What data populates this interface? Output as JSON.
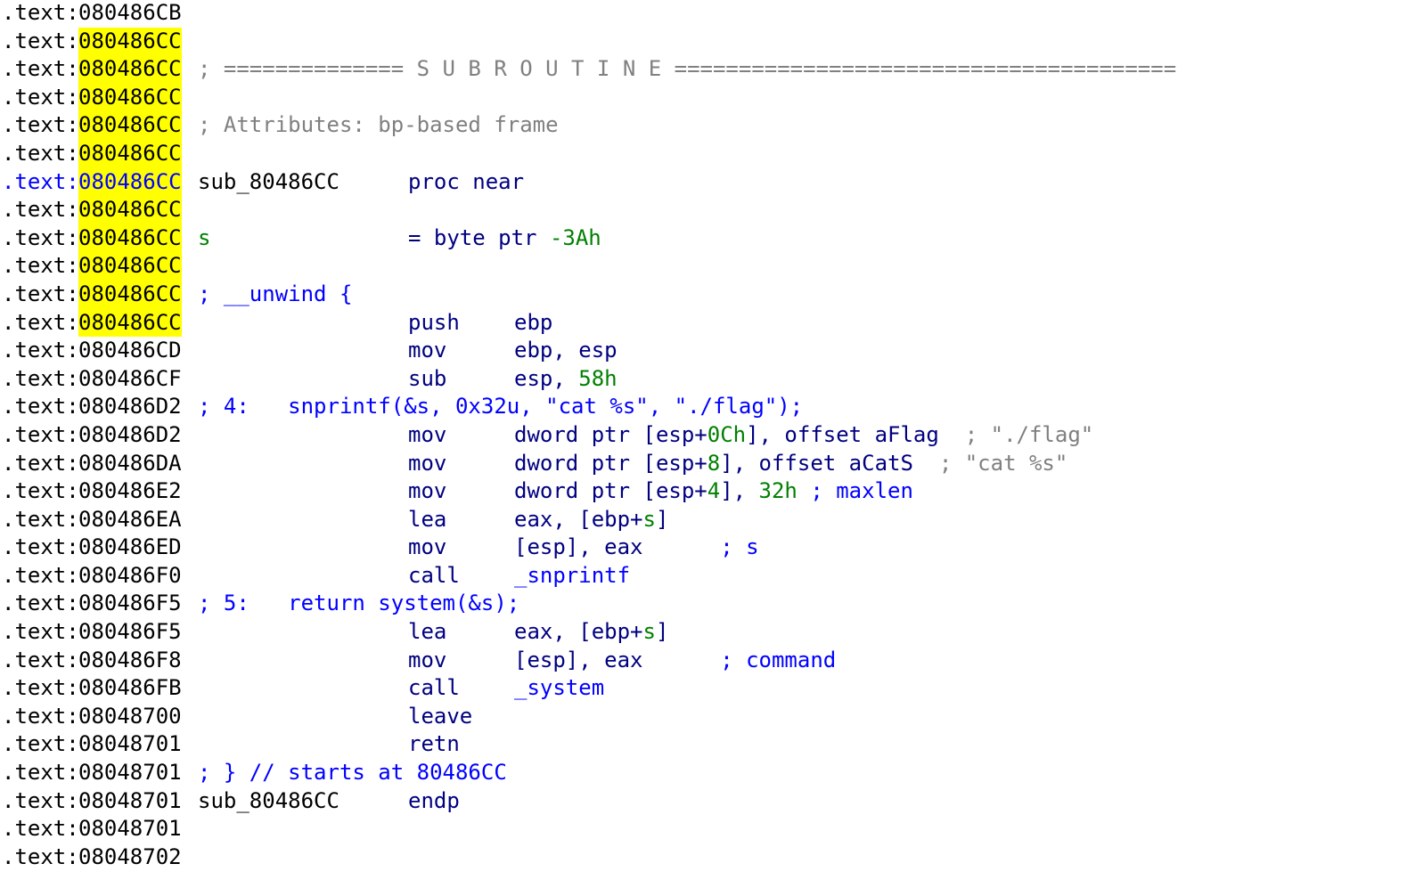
{
  "view": {
    "lines": [
      {
        "segment": ".text:",
        "address": "080486CB",
        "highlight": false,
        "seg_color": "black",
        "parts": []
      },
      {
        "segment": ".text:",
        "address": "080486CC",
        "highlight": true,
        "seg_color": "black",
        "parts": []
      },
      {
        "segment": ".text:",
        "address": "080486CC",
        "highlight": true,
        "seg_color": "black",
        "parts": [
          {
            "col": "c1",
            "text": "; ============== S U B R O U T I N E =======================================",
            "color": "gray"
          }
        ]
      },
      {
        "segment": ".text:",
        "address": "080486CC",
        "highlight": true,
        "seg_color": "black",
        "parts": []
      },
      {
        "segment": ".text:",
        "address": "080486CC",
        "highlight": true,
        "seg_color": "black",
        "parts": [
          {
            "col": "c1",
            "text": "; Attributes: bp-based frame",
            "color": "gray"
          }
        ]
      },
      {
        "segment": ".text:",
        "address": "080486CC",
        "highlight": true,
        "seg_color": "black",
        "parts": []
      },
      {
        "segment": ".text:",
        "address": "080486CC",
        "highlight": true,
        "seg_color": "blue",
        "parts": [
          {
            "col": "c1",
            "text": "sub_80486CC",
            "color": "black"
          },
          {
            "col": "c2",
            "text": "proc near",
            "color": "navy"
          }
        ]
      },
      {
        "segment": ".text:",
        "address": "080486CC",
        "highlight": true,
        "seg_color": "black",
        "parts": []
      },
      {
        "segment": ".text:",
        "address": "080486CC",
        "highlight": true,
        "seg_color": "black",
        "parts": [
          {
            "col": "c1",
            "text": "s",
            "color": "green"
          },
          {
            "col": "c2",
            "text": "= byte ptr ",
            "color": "navy"
          },
          {
            "col": "c2",
            "text": "           -3Ah",
            "color": "green"
          }
        ]
      },
      {
        "segment": ".text:",
        "address": "080486CC",
        "highlight": true,
        "seg_color": "black",
        "parts": []
      },
      {
        "segment": ".text:",
        "address": "080486CC",
        "highlight": true,
        "seg_color": "black",
        "parts": [
          {
            "col": "c1",
            "text": "; __unwind {",
            "color": "blue"
          }
        ]
      },
      {
        "segment": ".text:",
        "address": "080486CC",
        "highlight": true,
        "seg_color": "black",
        "parts": [
          {
            "col": "c2",
            "text": "push",
            "color": "navy"
          },
          {
            "col": "c3",
            "text": "ebp",
            "color": "navy"
          }
        ]
      },
      {
        "segment": ".text:",
        "address": "080486CD",
        "highlight": false,
        "seg_color": "black",
        "parts": [
          {
            "col": "c2",
            "text": "mov",
            "color": "navy"
          },
          {
            "col": "c3",
            "text": "ebp, esp",
            "color": "navy"
          }
        ]
      },
      {
        "segment": ".text:",
        "address": "080486CF",
        "highlight": false,
        "seg_color": "black",
        "parts": [
          {
            "col": "c2",
            "text": "sub",
            "color": "navy"
          },
          {
            "col": "c3",
            "text": "esp, ",
            "color": "navy"
          },
          {
            "col": "c3",
            "text": "     58h",
            "color": "green"
          }
        ]
      },
      {
        "segment": ".text:",
        "address": "080486D2",
        "highlight": false,
        "seg_color": "black",
        "parts": [
          {
            "col": "c1",
            "text": "; 4:   snprintf(&s, 0x32u, \"cat %s\", \"./flag\");",
            "color": "blue"
          }
        ]
      },
      {
        "segment": ".text:",
        "address": "080486D2",
        "highlight": false,
        "seg_color": "black",
        "parts": [
          {
            "col": "c2",
            "text": "mov",
            "color": "navy"
          },
          {
            "col": "c3",
            "text": "dword ptr [esp+",
            "color": "navy"
          },
          {
            "col": "c3",
            "text": "               0Ch",
            "color": "green"
          },
          {
            "col": "c3",
            "text": "                  ], offset aFlag",
            "color": "navy"
          },
          {
            "col": "c3",
            "text": "                                   ; \"./flag\"",
            "color": "gray"
          }
        ]
      },
      {
        "segment": ".text:",
        "address": "080486DA",
        "highlight": false,
        "seg_color": "black",
        "parts": [
          {
            "col": "c2",
            "text": "mov",
            "color": "navy"
          },
          {
            "col": "c3",
            "text": "dword ptr [esp+",
            "color": "navy"
          },
          {
            "col": "c3",
            "text": "               8",
            "color": "green"
          },
          {
            "col": "c3",
            "text": "                ], offset aCatS",
            "color": "navy"
          },
          {
            "col": "c3",
            "text": "                                 ; \"cat %s\"",
            "color": "gray"
          }
        ]
      },
      {
        "segment": ".text:",
        "address": "080486E2",
        "highlight": false,
        "seg_color": "black",
        "parts": [
          {
            "col": "c2",
            "text": "mov",
            "color": "navy"
          },
          {
            "col": "c3",
            "text": "dword ptr [esp+",
            "color": "navy"
          },
          {
            "col": "c3",
            "text": "               4",
            "color": "green"
          },
          {
            "col": "c3",
            "text": "                ], ",
            "color": "navy"
          },
          {
            "col": "c3",
            "text": "                   32h",
            "color": "green"
          },
          {
            "col": "c3",
            "text": "                       ; maxlen",
            "color": "blue"
          }
        ]
      },
      {
        "segment": ".text:",
        "address": "080486EA",
        "highlight": false,
        "seg_color": "black",
        "parts": [
          {
            "col": "c2",
            "text": "lea",
            "color": "navy"
          },
          {
            "col": "c3",
            "text": "eax, [ebp+",
            "color": "navy"
          },
          {
            "col": "c3",
            "text": "          s",
            "color": "green"
          },
          {
            "col": "c3",
            "text": "           ]",
            "color": "navy"
          }
        ]
      },
      {
        "segment": ".text:",
        "address": "080486ED",
        "highlight": false,
        "seg_color": "black",
        "parts": [
          {
            "col": "c2",
            "text": "mov",
            "color": "navy"
          },
          {
            "col": "c3",
            "text": "[esp], eax",
            "color": "navy"
          },
          {
            "col": "c3",
            "text": "                ; s",
            "color": "blue"
          }
        ]
      },
      {
        "segment": ".text:",
        "address": "080486F0",
        "highlight": false,
        "seg_color": "black",
        "parts": [
          {
            "col": "c2",
            "text": "call",
            "color": "navy"
          },
          {
            "col": "c3",
            "text": "_snprintf",
            "color": "blue"
          }
        ]
      },
      {
        "segment": ".text:",
        "address": "080486F5",
        "highlight": false,
        "seg_color": "black",
        "parts": [
          {
            "col": "c1",
            "text": "; 5:   return system(&s);",
            "color": "blue"
          }
        ]
      },
      {
        "segment": ".text:",
        "address": "080486F5",
        "highlight": false,
        "seg_color": "black",
        "parts": [
          {
            "col": "c2",
            "text": "lea",
            "color": "navy"
          },
          {
            "col": "c3",
            "text": "eax, [ebp+",
            "color": "navy"
          },
          {
            "col": "c3",
            "text": "          s",
            "color": "green"
          },
          {
            "col": "c3",
            "text": "           ]",
            "color": "navy"
          }
        ]
      },
      {
        "segment": ".text:",
        "address": "080486F8",
        "highlight": false,
        "seg_color": "black",
        "parts": [
          {
            "col": "c2",
            "text": "mov",
            "color": "navy"
          },
          {
            "col": "c3",
            "text": "[esp], eax",
            "color": "navy"
          },
          {
            "col": "c3",
            "text": "                ; command",
            "color": "blue"
          }
        ]
      },
      {
        "segment": ".text:",
        "address": "080486FB",
        "highlight": false,
        "seg_color": "black",
        "parts": [
          {
            "col": "c2",
            "text": "call",
            "color": "navy"
          },
          {
            "col": "c3",
            "text": "_system",
            "color": "blue"
          }
        ]
      },
      {
        "segment": ".text:",
        "address": "08048700",
        "highlight": false,
        "seg_color": "black",
        "parts": [
          {
            "col": "c2",
            "text": "leave",
            "color": "navy"
          }
        ]
      },
      {
        "segment": ".text:",
        "address": "08048701",
        "highlight": false,
        "seg_color": "black",
        "parts": [
          {
            "col": "c2",
            "text": "retn",
            "color": "navy"
          }
        ]
      },
      {
        "segment": ".text:",
        "address": "08048701",
        "highlight": false,
        "seg_color": "black",
        "parts": [
          {
            "col": "c1",
            "text": "; } // starts at 80486CC",
            "color": "blue"
          }
        ]
      },
      {
        "segment": ".text:",
        "address": "08048701",
        "highlight": false,
        "seg_color": "black",
        "parts": [
          {
            "col": "c1",
            "text": "sub_80486CC",
            "color": "black"
          },
          {
            "col": "c2",
            "text": "endp",
            "color": "navy"
          }
        ]
      },
      {
        "segment": ".text:",
        "address": "08048701",
        "highlight": false,
        "seg_color": "black",
        "parts": []
      },
      {
        "segment": ".text:",
        "address": "08048702",
        "highlight": false,
        "seg_color": "black",
        "parts": []
      }
    ]
  },
  "colors": {
    "black": "#000000",
    "blue": "#0000ff",
    "navy": "#000080",
    "green": "#008000",
    "gray": "#808080",
    "highlight": "#ffff00",
    "background": "#ffffff"
  }
}
